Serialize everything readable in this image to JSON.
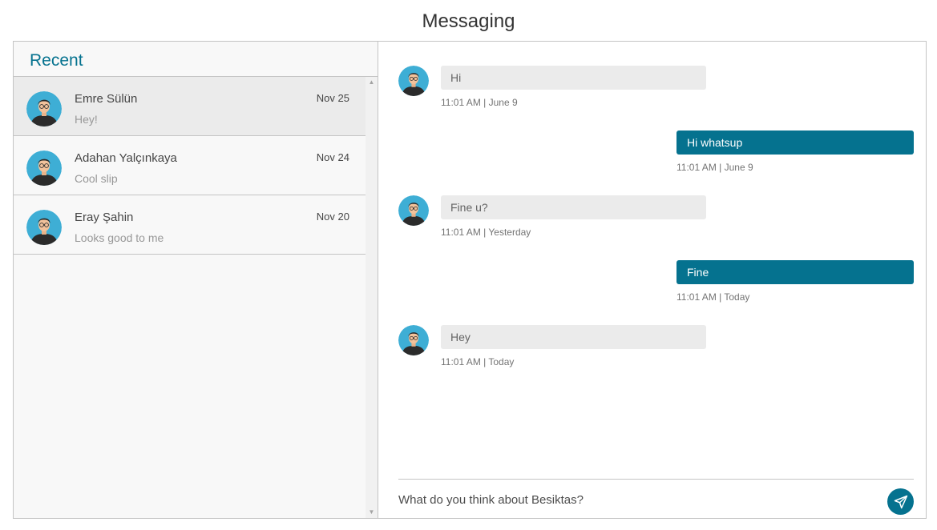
{
  "page": {
    "title": "Messaging"
  },
  "inbox": {
    "header": "Recent",
    "chats": [
      {
        "name": "Emre Sülün",
        "date": "Nov 25",
        "preview": "Hey!",
        "active": true
      },
      {
        "name": "Adahan Yalçınkaya",
        "date": "Nov 24",
        "preview": "Cool slip",
        "active": false
      },
      {
        "name": "Eray Şahin",
        "date": "Nov 20",
        "preview": "Looks good to me",
        "active": false
      }
    ],
    "scroll_up_icon": "triangle-up-icon",
    "scroll_down_icon": "triangle-down-icon"
  },
  "conversation": {
    "messages": [
      {
        "direction": "incoming",
        "text": "Hi",
        "time": "11:01 AM | June 9"
      },
      {
        "direction": "outgoing",
        "text": "Hi whatsup",
        "time": "11:01 AM | June 9"
      },
      {
        "direction": "incoming",
        "text": "Fine u?",
        "time": "11:01 AM | Yesterday"
      },
      {
        "direction": "outgoing",
        "text": "Fine",
        "time": "11:01 AM | Today"
      },
      {
        "direction": "incoming",
        "text": "Hey",
        "time": "11:01 AM | Today"
      }
    ],
    "input_value": "What do you think about Besiktas?",
    "send_icon": "paper-plane-icon"
  },
  "colors": {
    "accent": "#05728f",
    "incoming_bubble": "#ebebeb",
    "inbox_bg": "#f8f8f8",
    "active_chat_bg": "#ebebeb",
    "avatar_bg": "#3eaed5",
    "border": "#c4c4c4"
  }
}
